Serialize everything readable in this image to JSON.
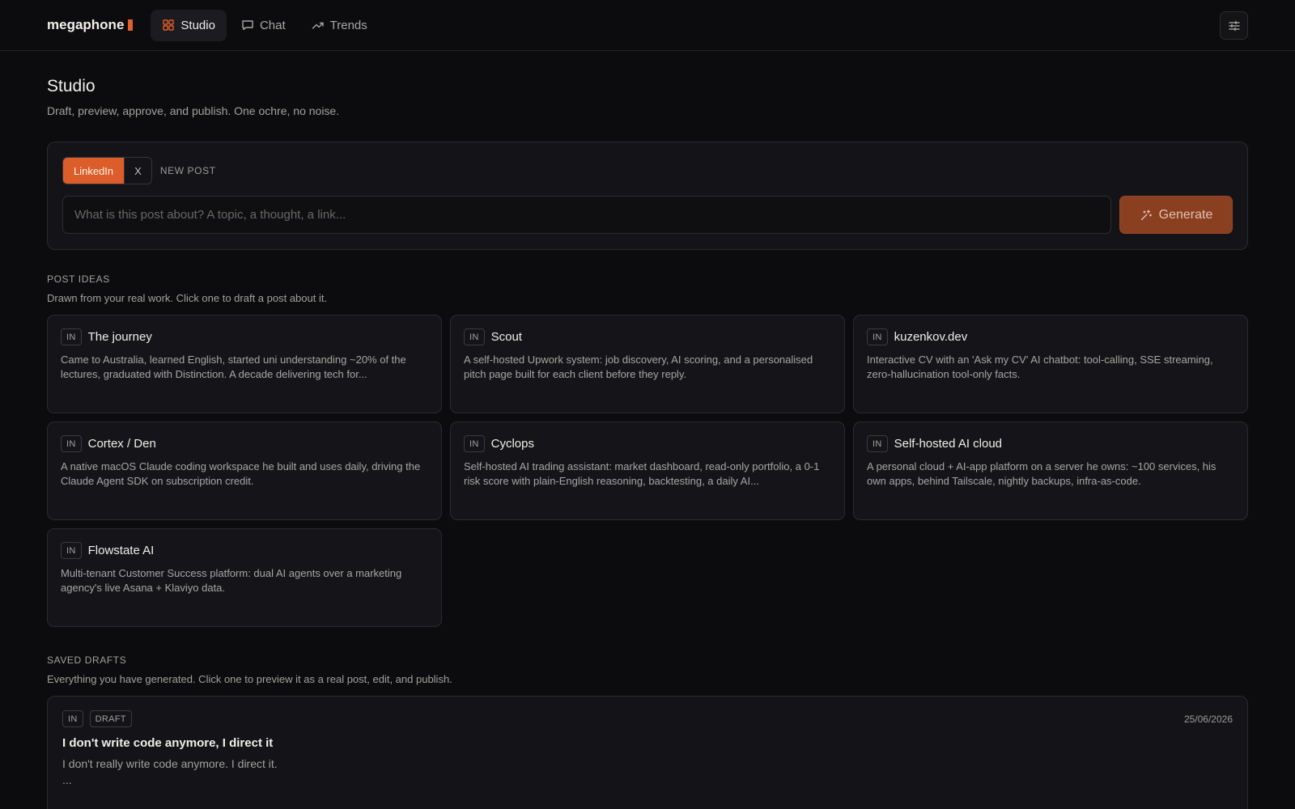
{
  "brand": {
    "name": "megaphone",
    "accent": "#e0602a"
  },
  "nav": {
    "items": [
      {
        "label": "Studio",
        "icon": "grid-icon",
        "active": true
      },
      {
        "label": "Chat",
        "icon": "message-icon",
        "active": false
      },
      {
        "label": "Trends",
        "icon": "trending-up-icon",
        "active": false
      }
    ],
    "settings_icon": "sliders-icon"
  },
  "page": {
    "title": "Studio",
    "subtitle": "Draft, preview, approve, and publish. One ochre, no noise."
  },
  "composer": {
    "platforms": [
      "LinkedIn",
      "X"
    ],
    "selected_platform": "LinkedIn",
    "mode_label": "NEW POST",
    "input_placeholder": "What is this post about? A topic, a thought, a link...",
    "input_value": "",
    "generate_label": "Generate"
  },
  "ideas": {
    "label": "POST IDEAS",
    "subtitle": "Drawn from your real work. Click one to draft a post about it.",
    "items": [
      {
        "tag": "IN",
        "title": "The journey",
        "desc": "Came to Australia, learned English, started uni understanding ~20% of the lectures, graduated with Distinction. A decade delivering tech for..."
      },
      {
        "tag": "IN",
        "title": "Scout",
        "desc": "A self-hosted Upwork system: job discovery, AI scoring, and a personalised pitch page built for each client before they reply."
      },
      {
        "tag": "IN",
        "title": "kuzenkov.dev",
        "desc": "Interactive CV with an 'Ask my CV' AI chatbot: tool-calling, SSE streaming, zero-hallucination tool-only facts."
      },
      {
        "tag": "IN",
        "title": "Cortex / Den",
        "desc": "A native macOS Claude coding workspace he built and uses daily, driving the Claude Agent SDK on subscription credit."
      },
      {
        "tag": "IN",
        "title": "Cyclops",
        "desc": "Self-hosted AI trading assistant: market dashboard, read-only portfolio, a 0-1 risk score with plain-English reasoning, backtesting, a daily AI..."
      },
      {
        "tag": "IN",
        "title": "Self-hosted AI cloud",
        "desc": "A personal cloud + AI-app platform on a server he owns: ~100 services, his own apps, behind Tailscale, nightly backups, infra-as-code."
      },
      {
        "tag": "IN",
        "title": "Flowstate AI",
        "desc": "Multi-tenant Customer Success platform: dual AI agents over a marketing agency's live Asana + Klaviyo data."
      }
    ]
  },
  "drafts": {
    "label": "SAVED DRAFTS",
    "subtitle": "Everything you have generated. Click one to preview it as a real post, edit, and publish.",
    "items": [
      {
        "platform_tag": "IN",
        "status": "DRAFT",
        "date": "25/06/2026",
        "title": "I don't write code anymore, I direct it",
        "preview": "I don't really write code anymore. I direct it.",
        "more": "..."
      }
    ]
  }
}
